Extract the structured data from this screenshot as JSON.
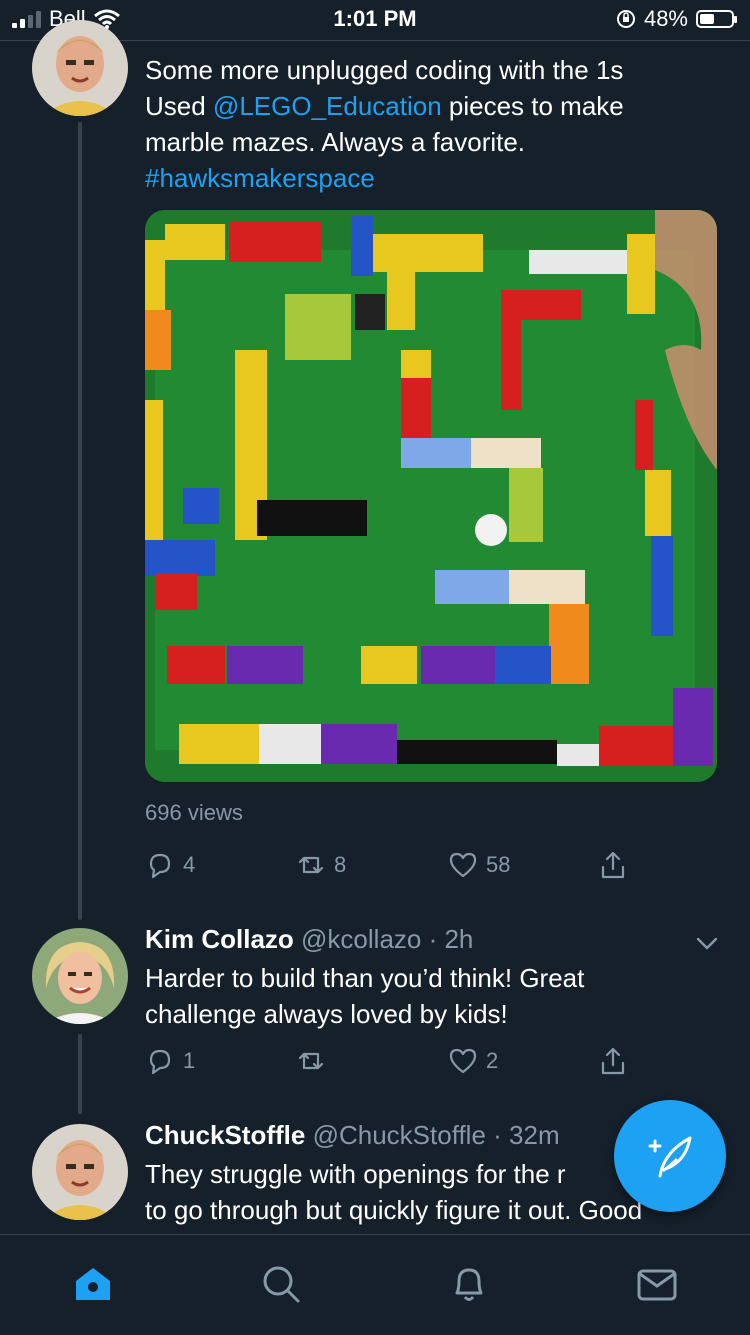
{
  "status_bar": {
    "carrier": "Bell",
    "time": "1:01 PM",
    "battery": "48%",
    "battery_level": 0.48
  },
  "tweet_main": {
    "text_line1": "Some more unplugged coding with the 1s",
    "text_used": "Used ",
    "mention": "@LEGO_Education",
    "text_after_mention": " pieces to make",
    "text_line3": "marble mazes. Always a favorite.",
    "hashtag": "#hawksmakerspace",
    "views": "696 views",
    "replies": "4",
    "retweets": "8",
    "likes": "58",
    "image_icon": "lego-marble-maze-photo"
  },
  "reply_1": {
    "name": "Kim Collazo",
    "handle": "@kcollazo",
    "time": "· 2h",
    "text": "Harder to build than you’d think! Great\nchallenge always loved by kids!",
    "replies": "1",
    "retweets": "",
    "likes": "2"
  },
  "reply_2": {
    "name": "ChuckStoffle",
    "handle": "@ChuckStoffle",
    "time": "· 32m",
    "text": "They struggle with openings for the r\nto go through but quickly figure it out. Good"
  },
  "colors": {
    "background": "#15202b",
    "accent": "#1da1f2",
    "muted": "#8899a6",
    "divider": "#38444d"
  },
  "tabbar": {
    "tabs": [
      "home-icon",
      "search-icon",
      "notifications-icon",
      "messages-icon"
    ],
    "active": "home-icon"
  }
}
